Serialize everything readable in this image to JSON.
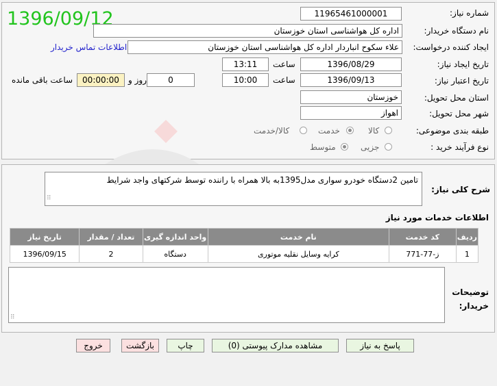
{
  "header": {
    "date_stamp": "1396/09/12"
  },
  "form": {
    "need_number": {
      "label": "شماره نیاز:",
      "value": "11965461000001"
    },
    "buyer_org": {
      "label": "نام دستگاه خریدار:",
      "value": "اداره کل هواشناسی استان خوزستان"
    },
    "requester": {
      "label": "ایجاد کننده درخواست:",
      "value": "علاء سکوح انباردار اداره کل هواشناسی استان خوزستان",
      "contact_link": "اطلاعات تماس خریدار"
    },
    "created": {
      "label": "تاریخ ایجاد نیاز:",
      "date": "1396/08/29",
      "time_label": "ساعت",
      "time": "13:11"
    },
    "validity": {
      "label": "تاریخ اعتبار نیاز:",
      "date": "1396/09/13",
      "time_label": "ساعت",
      "time": "10:00",
      "days": "0",
      "days_label": "روز و",
      "remaining": "00:00:00",
      "remaining_label": "ساعت باقی مانده"
    },
    "province": {
      "label": "استان محل تحویل:",
      "value": "خوزستان"
    },
    "city": {
      "label": "شهر محل تحویل:",
      "value": "اهواز"
    },
    "category": {
      "label": "طبقه بندی موضوعی:",
      "options": [
        "کالا",
        "خدمت",
        "کالا/خدمت"
      ],
      "selected": "خدمت"
    },
    "process": {
      "label": "نوع فرآیند خرید :",
      "options": [
        "جزیی",
        "متوسط"
      ],
      "selected": "متوسط"
    }
  },
  "description": {
    "label": "شرح کلی نیاز:",
    "text": "تامین 2دستگاه خودرو سواری مدل1395به بالا  همراه با راننده توسط شرکتهای واجد شرایط"
  },
  "services": {
    "title": "اطلاعات خدمات مورد نیاز",
    "columns": [
      "ردیف",
      "کد خدمت",
      "نام خدمت",
      "واحد اندازه گیری",
      "تعداد / مقدار",
      "تاریخ نیاز"
    ],
    "rows": [
      [
        "1",
        "ز-77-771",
        "کرایه وسایل نقلیه موتوری",
        "دستگاه",
        "2",
        "1396/09/15"
      ]
    ]
  },
  "buyer_notes": {
    "label_line1": "توضیحات",
    "label_line2": "خریدار:",
    "value": ""
  },
  "buttons": {
    "reply": "پاسخ به نیاز",
    "attachments": "مشاهده مدارک پیوستی (0)",
    "print": "چاپ",
    "back": "بازگشت",
    "exit": "خروج"
  },
  "colors": {
    "date_stamp": "#22c41e",
    "link": "#2222cc",
    "table_header": "#8b8b8b",
    "button_green": "#e9f6e1",
    "button_pink": "#fbe0e0"
  }
}
